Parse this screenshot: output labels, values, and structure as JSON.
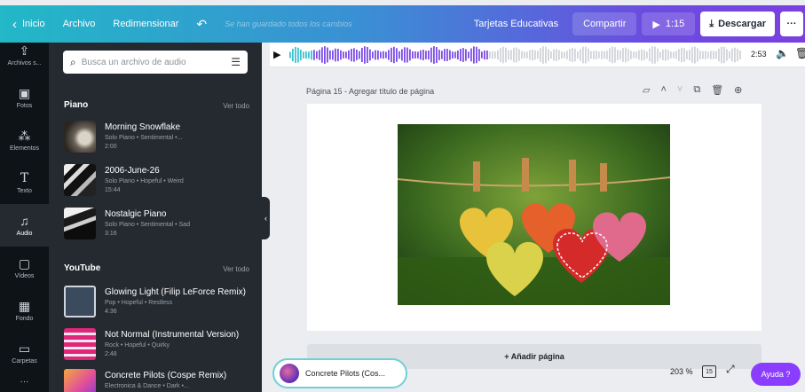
{
  "topbar": {
    "home": "Inicio",
    "file": "Archivo",
    "resize": "Redimensionar",
    "undo_icon": "undo-icon",
    "status": "Se han guardado todos los cambios",
    "design_name": "Tarjetas Educativas",
    "share": "Compartir",
    "play_time": "1:15",
    "download": "Descargar",
    "more": "···"
  },
  "rail": {
    "items": [
      {
        "label": "Archivos s...",
        "icon": "upload-icon"
      },
      {
        "label": "Fotos",
        "icon": "photo-icon"
      },
      {
        "label": "Elementos",
        "icon": "shapes-icon"
      },
      {
        "label": "Texto",
        "icon": "text-icon"
      },
      {
        "label": "Audio",
        "icon": "music-icon"
      },
      {
        "label": "Vídeos",
        "icon": "video-icon"
      },
      {
        "label": "Fondo",
        "icon": "background-icon"
      },
      {
        "label": "Carpetas",
        "icon": "folder-icon"
      }
    ]
  },
  "panel": {
    "search_placeholder": "Busca un archivo de audio",
    "piano": {
      "title": "Piano",
      "see_all": "Ver todo",
      "tracks": [
        {
          "title": "Morning Snowflake",
          "tags": "Solo Piano • Sentimental •...",
          "duration": "2:00"
        },
        {
          "title": "2006-June-26",
          "tags": "Solo Piano • Hopeful • Weird",
          "duration": "15:44"
        },
        {
          "title": "Nostalgic Piano",
          "tags": "Solo Piano • Sentimental • Sad",
          "duration": "3:16"
        }
      ]
    },
    "youtube": {
      "title": "YouTube",
      "see_all": "Ver todo",
      "tracks": [
        {
          "title": "Glowing Light (Filip LeForce Remix)",
          "tags": "Pop • Hopeful • Restless",
          "duration": "4:36"
        },
        {
          "title": "Not Normal (Instrumental Version)",
          "tags": "Rock • Hopeful • Quirky",
          "duration": "2:48"
        },
        {
          "title": "Concrete Pilots (Cospe Remix)",
          "tags": "Electronica & Dance • Dark •...",
          "duration": ""
        }
      ]
    }
  },
  "audiobar": {
    "progress": 0.44,
    "duration": "2:53"
  },
  "canvas": {
    "page_label": "Página 15 - Agregar título de página",
    "add_page": "+ Añadir página"
  },
  "bottom": {
    "now_playing": "Concrete Pilots (Cos...",
    "zoom": "203 %",
    "page_count": "15",
    "help": "Ayuda ?"
  },
  "colors": {
    "accent": "#8b3dff",
    "wave_played": "#7c4de8",
    "wave_unplayed": "#d0d3d8"
  }
}
